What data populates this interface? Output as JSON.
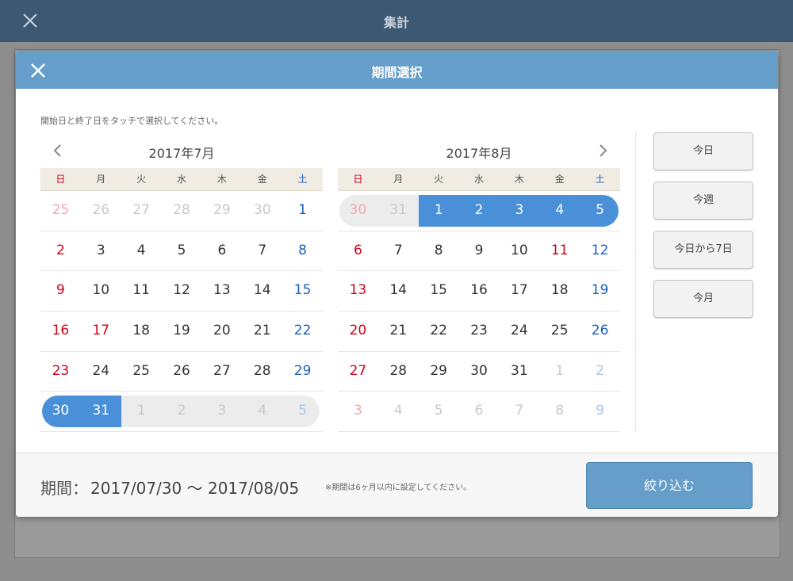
{
  "app": {
    "title": "集計"
  },
  "modal": {
    "title": "期間選択",
    "instruction": "開始日と終了日をタッチで選択してください。"
  },
  "weekdays": [
    "日",
    "月",
    "火",
    "水",
    "木",
    "金",
    "土"
  ],
  "calendars": [
    {
      "title": "2017年7月",
      "weeks": [
        [
          "25",
          "26",
          "27",
          "28",
          "29",
          "30",
          "1"
        ],
        [
          "2",
          "3",
          "4",
          "5",
          "6",
          "7",
          "8"
        ],
        [
          "9",
          "10",
          "11",
          "12",
          "13",
          "14",
          "15"
        ],
        [
          "16",
          "17",
          "18",
          "19",
          "20",
          "21",
          "22"
        ],
        [
          "23",
          "24",
          "25",
          "26",
          "27",
          "28",
          "29"
        ],
        [
          "30",
          "31",
          "1",
          "2",
          "3",
          "4",
          "5"
        ]
      ],
      "holiday": "17",
      "selected_range": "2017/07/30 - 2017/07/31"
    },
    {
      "title": "2017年8月",
      "weeks": [
        [
          "30",
          "31",
          "1",
          "2",
          "3",
          "4",
          "5"
        ],
        [
          "6",
          "7",
          "8",
          "9",
          "10",
          "11",
          "12"
        ],
        [
          "13",
          "14",
          "15",
          "16",
          "17",
          "18",
          "19"
        ],
        [
          "20",
          "21",
          "22",
          "23",
          "24",
          "25",
          "26"
        ],
        [
          "27",
          "28",
          "29",
          "30",
          "31",
          "1",
          "2"
        ],
        [
          "3",
          "4",
          "5",
          "6",
          "7",
          "8",
          "9"
        ]
      ],
      "holiday": "11",
      "selected_range": "2017/08/01 - 2017/08/05"
    }
  ],
  "quick_buttons": [
    "今日",
    "今週",
    "今日から7日",
    "今月"
  ],
  "footer": {
    "period_label": "期間：",
    "period_value": "2017/07/30 〜 2017/08/05",
    "note": "※期間は6ヶ月以内に設定してください。",
    "apply_label": "絞り込む"
  },
  "colors": {
    "accent": "#649ec9",
    "selected": "#4a90d9",
    "range_bg": "#ececec",
    "sunday": "#d0021b",
    "saturday": "#1a5fc0"
  }
}
